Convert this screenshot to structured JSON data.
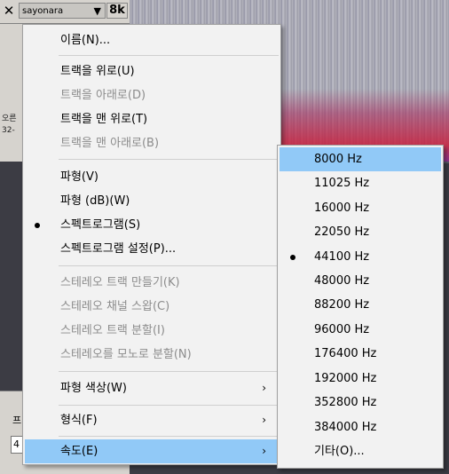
{
  "track": {
    "name": "sayonara",
    "rate_badge": "8k",
    "close_glyph": "✕",
    "dropdown_glyph": "▼",
    "side_labels": [
      "오른",
      "32-"
    ],
    "bottom_label": "프",
    "bottom_input_value": "4"
  },
  "menu": {
    "items": [
      {
        "label": "이름(N)...",
        "enabled": true
      },
      {
        "label": "트랙을 위로(U)",
        "enabled": true
      },
      {
        "label": "트랙을 아래로(D)",
        "enabled": false
      },
      {
        "label": "트랙을 맨 위로(T)",
        "enabled": true
      },
      {
        "label": "트랙을 맨 아래로(B)",
        "enabled": false
      },
      {
        "label": "파형(V)",
        "enabled": true
      },
      {
        "label": "파형 (dB)(W)",
        "enabled": true
      },
      {
        "label": "스펙트로그램(S)",
        "enabled": true,
        "checked": true
      },
      {
        "label": "스펙트로그램 설정(P)...",
        "enabled": true
      },
      {
        "label": "스테레오 트랙 만들기(K)",
        "enabled": false
      },
      {
        "label": "스테레오 채널 스왑(C)",
        "enabled": false
      },
      {
        "label": "스테레오 트랙 분할(I)",
        "enabled": false
      },
      {
        "label": "스테레오를 모노로 분할(N)",
        "enabled": false
      },
      {
        "label": "파형 색상(W)",
        "enabled": true,
        "submenu": true
      },
      {
        "label": "형식(F)",
        "enabled": true,
        "submenu": true
      },
      {
        "label": "속도(E)",
        "enabled": true,
        "submenu": true,
        "highlighted": true
      }
    ],
    "submenu_arrow": "›"
  },
  "rate_submenu": {
    "items": [
      {
        "label": "8000 Hz",
        "highlighted": true
      },
      {
        "label": "11025 Hz"
      },
      {
        "label": "16000 Hz"
      },
      {
        "label": "22050 Hz"
      },
      {
        "label": "44100 Hz",
        "checked": true
      },
      {
        "label": "48000 Hz"
      },
      {
        "label": "88200 Hz"
      },
      {
        "label": "96000 Hz"
      },
      {
        "label": "176400 Hz"
      },
      {
        "label": "192000 Hz"
      },
      {
        "label": "352800 Hz"
      },
      {
        "label": "384000 Hz"
      },
      {
        "label": "기타(O)..."
      }
    ]
  },
  "colors": {
    "highlight": "#91c9f7",
    "menu_bg": "#f2f2f2",
    "disabled_text": "#8c8c8c"
  }
}
